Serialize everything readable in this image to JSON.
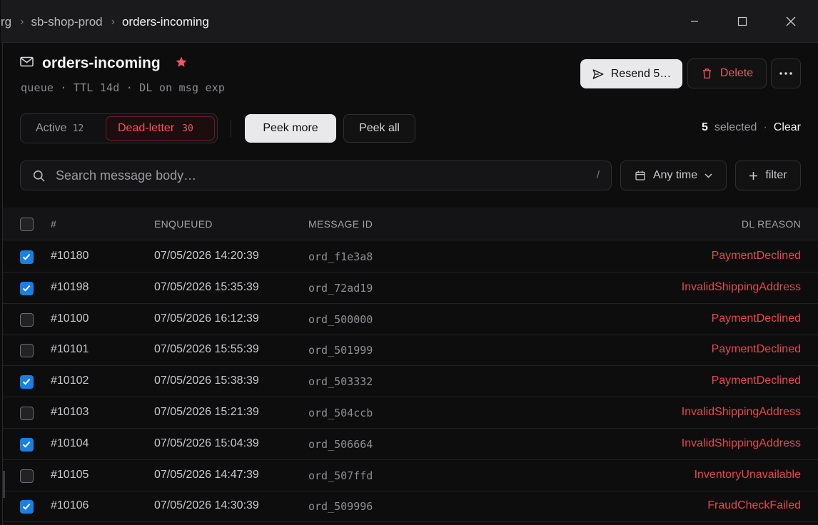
{
  "breadcrumb": {
    "org": "rg",
    "namespace": "sb-shop-prod",
    "current": "orders-incoming"
  },
  "header": {
    "title": "orders-incoming",
    "subtitle": "queue · TTL 14d · DL on msg exp",
    "resend_label": "Resend 5…",
    "delete_label": "Delete"
  },
  "tabs": {
    "active_label": "Active",
    "active_count": "12",
    "deadletter_label": "Dead-letter",
    "deadletter_count": "30"
  },
  "actions": {
    "peek_more": "Peek more",
    "peek_all": "Peek all"
  },
  "selection": {
    "count": "5",
    "label": "selected",
    "sep": "·",
    "clear": "Clear"
  },
  "search": {
    "placeholder": "Search message body…",
    "shortcut": "/"
  },
  "filters": {
    "time": "Any time",
    "add_filter": "filter"
  },
  "table": {
    "headers": {
      "num": "#",
      "enqueued": "ENQUEUED",
      "message_id": "MESSAGE ID",
      "reason": "DL REASON"
    },
    "rows": [
      {
        "checked": true,
        "num": "#10180",
        "enqueued": "07/05/2026 14:20:39",
        "id": "ord_f1e3a8",
        "reason": "PaymentDeclined"
      },
      {
        "checked": true,
        "num": "#10198",
        "enqueued": "07/05/2026 15:35:39",
        "id": "ord_72ad19",
        "reason": "InvalidShippingAddress"
      },
      {
        "checked": false,
        "num": "#10100",
        "enqueued": "07/05/2026 16:12:39",
        "id": "ord_500000",
        "reason": "PaymentDeclined"
      },
      {
        "checked": false,
        "num": "#10101",
        "enqueued": "07/05/2026 15:55:39",
        "id": "ord_501999",
        "reason": "PaymentDeclined"
      },
      {
        "checked": true,
        "num": "#10102",
        "enqueued": "07/05/2026 15:38:39",
        "id": "ord_503332",
        "reason": "PaymentDeclined"
      },
      {
        "checked": false,
        "num": "#10103",
        "enqueued": "07/05/2026 15:21:39",
        "id": "ord_504ccb",
        "reason": "InvalidShippingAddress"
      },
      {
        "checked": true,
        "num": "#10104",
        "enqueued": "07/05/2026 15:04:39",
        "id": "ord_506664",
        "reason": "InvalidShippingAddress"
      },
      {
        "checked": false,
        "num": "#10105",
        "enqueued": "07/05/2026 14:47:39",
        "id": "ord_507ffd",
        "reason": "InventoryUnavailable"
      },
      {
        "checked": true,
        "num": "#10106",
        "enqueued": "07/05/2026 14:30:39",
        "id": "ord_509996",
        "reason": "FraudCheckFailed"
      }
    ]
  },
  "icons": {
    "queue": "mail-icon",
    "favorite": "star-icon",
    "resend": "send-icon",
    "delete": "trash-icon",
    "more": "ellipsis-icon",
    "search": "search-icon",
    "calendar": "calendar-icon",
    "chevron": "chevron-down-icon",
    "add": "plus-icon"
  },
  "colors": {
    "accent_blue": "#1a7fe0",
    "danger": "#e5484d",
    "star": "#f0575c"
  }
}
